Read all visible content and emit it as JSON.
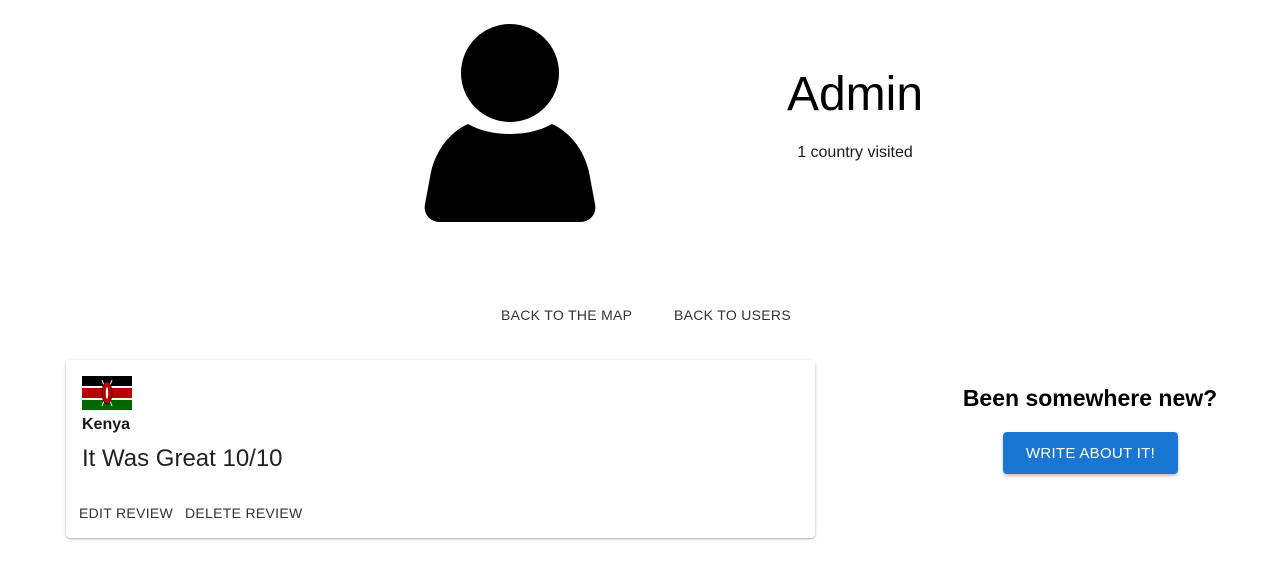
{
  "profile": {
    "avatar_icon": "person-icon",
    "username": "Admin",
    "visited_text": "1 country visited"
  },
  "nav": {
    "back_to_map": "BACK TO THE MAP",
    "back_to_users": "BACK TO USERS"
  },
  "reviews": [
    {
      "flag_icon": "kenya-flag-icon",
      "country": "Kenya",
      "text": "It Was Great 10/10",
      "edit_label": "EDIT REVIEW",
      "delete_label": "DELETE REVIEW"
    }
  ],
  "cta": {
    "heading": "Been somewhere new?",
    "button_label": "WRITE ABOUT IT!",
    "button_color": "#1976d2"
  }
}
